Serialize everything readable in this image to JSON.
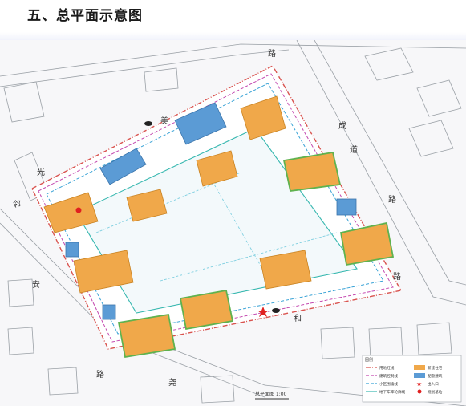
{
  "page": {
    "title": "五、总平面示意图"
  },
  "roads": {
    "north": "路",
    "northeast_1": "成",
    "northeast_2": "道",
    "west_1": "邻",
    "west_2": "安",
    "west_3": "路",
    "east": "路",
    "south_1": "和",
    "south_2": "路",
    "south_3": "尧",
    "northwest_1": "美",
    "northwest_2": "光"
  },
  "scale_label": "总平面图 1:00",
  "legend": {
    "title": "图例",
    "items": [
      {
        "label": "用地红线",
        "swatch": "line",
        "color": "#d9534f",
        "dash": "6 2 1 2"
      },
      {
        "label": "建筑控制线",
        "swatch": "line",
        "color": "#c44ab0",
        "dash": "4 2"
      },
      {
        "label": "小区围墙线",
        "swatch": "line",
        "color": "#3aa3d6",
        "dash": "4 2"
      },
      {
        "label": "地下车库轮廓线",
        "swatch": "line",
        "color": "#38b8b0",
        "dash": ""
      },
      {
        "label": "新建住宅",
        "swatch": "fill",
        "color": "#f0a84a"
      },
      {
        "label": "配套建筑",
        "swatch": "fill",
        "color": "#5b9bd5"
      },
      {
        "label": "出入口",
        "swatch": "star",
        "color": "#e02020"
      },
      {
        "label": "规划基站",
        "swatch": "dot",
        "color": "#e02020"
      }
    ]
  },
  "colors": {
    "residential": "#f0a84a",
    "residential_stroke": "#c98322",
    "facility": "#5b9bd5",
    "facility_stroke": "#3b74aa",
    "green_edge": "#5fb24f",
    "redline": "#d9534f",
    "control_line": "#c44ab0",
    "wall_line": "#3aa3d6",
    "garage_line": "#38b8b0"
  }
}
